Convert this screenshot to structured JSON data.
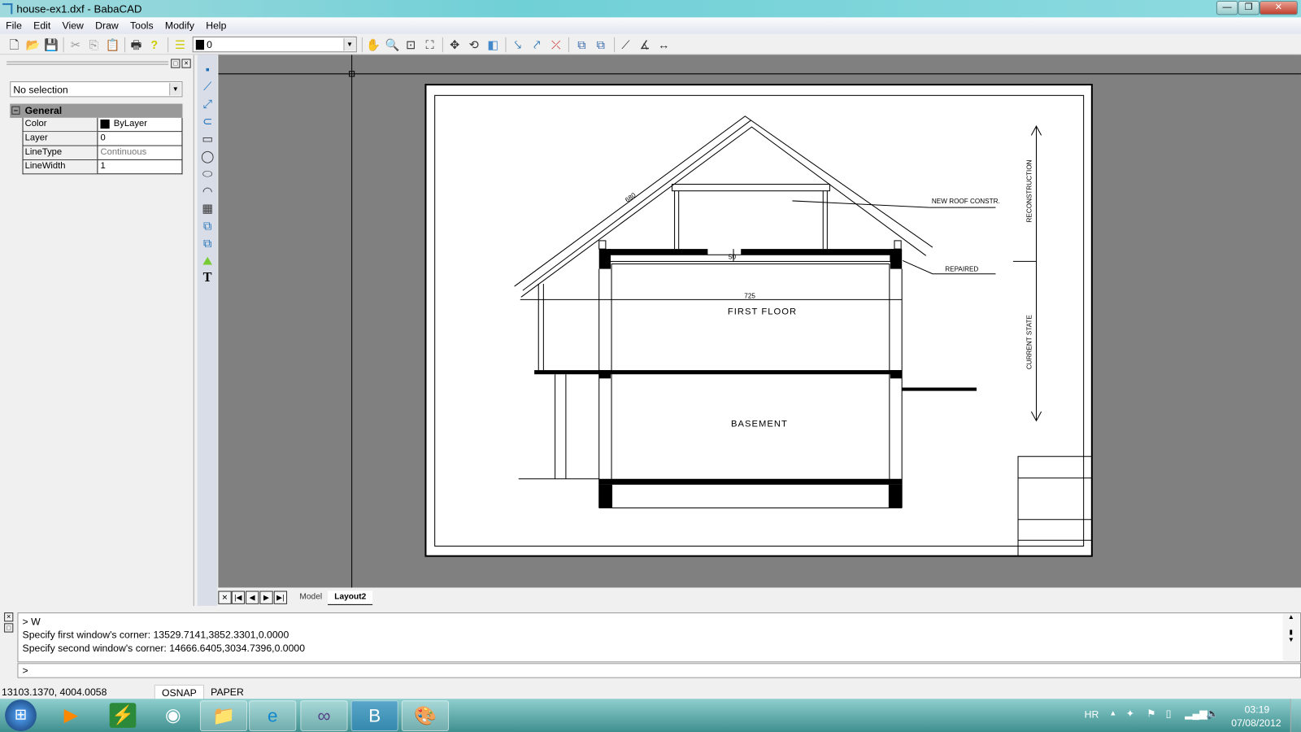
{
  "window": {
    "title": "house-ex1.dxf - BabaCAD",
    "min": "—",
    "max": "❐",
    "close": "✕"
  },
  "menu": [
    "File",
    "Edit",
    "View",
    "Draw",
    "Tools",
    "Modify",
    "Help"
  ],
  "toolbar": {
    "layer_value": "0"
  },
  "properties": {
    "selection": "No selection",
    "group": "General",
    "rows": [
      {
        "k": "Color",
        "v": "ByLayer"
      },
      {
        "k": "Layer",
        "v": "0"
      },
      {
        "k": "LineType",
        "v": "Continuous"
      },
      {
        "k": "LineWidth",
        "v": "1"
      }
    ],
    "color_swatch": "#000000"
  },
  "drawing": {
    "labels": {
      "roof_len": "680",
      "span": "725",
      "small_dim": "50",
      "first_floor": "FIRST FLOOR",
      "basement": "BASEMENT",
      "new_roof": "NEW ROOF CONSTR.",
      "repaired": "REPAIRED",
      "reconstruction": "RECONSTRUCTION",
      "current_state": "CURRENT STATE"
    }
  },
  "tabs": {
    "model": "Model",
    "layout": "Layout2",
    "active": "Layout2"
  },
  "command": {
    "history": [
      "> W",
      "Specify first window's corner: 13529.7141,3852.3301,0.0000",
      "Specify second window's corner: 14666.6405,3034.7396,0.0000"
    ],
    "prompt": ">"
  },
  "status": {
    "coords": "13103.1370, 4004.0058",
    "osnap": "OSNAP",
    "paper": "PAPER"
  },
  "taskbar": {
    "lang": "HR",
    "time": "03:19",
    "date": "07/08/2012",
    "apps": [
      "windows-media-player",
      "task-manager",
      "network",
      "explorer",
      "internet-explorer",
      "visual-studio",
      "babacad",
      "paint"
    ]
  }
}
